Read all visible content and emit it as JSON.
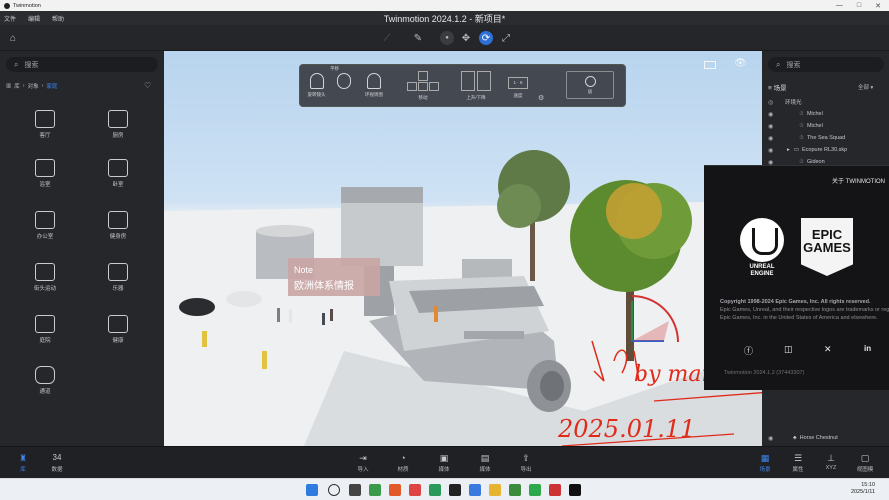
{
  "window": {
    "app_name": "Twinmotion",
    "title": "Twinmotion 2024.1.2 - 新项目*",
    "controls": [
      "—",
      "□",
      "✕"
    ]
  },
  "menu": [
    "文件",
    "编辑",
    "帮助"
  ],
  "left_panel": {
    "search_placeholder": "搜索",
    "breadcrumb": [
      "库",
      "对象",
      "家庭"
    ],
    "categories": [
      {
        "label": "客厅",
        "icon": "sofa-lamp-icon"
      },
      {
        "label": "厨房",
        "icon": "kitchen-icon"
      },
      {
        "label": "浴室",
        "icon": "bath-icon"
      },
      {
        "label": "卧室",
        "icon": "bed-icon"
      },
      {
        "label": "办公室",
        "icon": "desk-icon"
      },
      {
        "label": "健身房",
        "icon": "gym-icon"
      },
      {
        "label": "街头运动",
        "icon": "street-sport-icon"
      },
      {
        "label": "乐器",
        "icon": "guitar-icon"
      },
      {
        "label": "庭院",
        "icon": "garden-fence-icon"
      },
      {
        "label": "健康",
        "icon": "health-icon"
      },
      {
        "label": "通道",
        "icon": "barrel-icon"
      }
    ]
  },
  "viewport_toolbar": {
    "top_label": "平移",
    "items": [
      "旋转镜头",
      "环视周围",
      "移动",
      "上升/下降",
      "速度"
    ],
    "speed_value": "1 · 6",
    "center_button": "居"
  },
  "viewport_overlay_text": {
    "sign_line1": "Note",
    "sign_line2": "欧洲体系情报"
  },
  "handwriting": {
    "line1": "by mango",
    "line2": "2025.01.11"
  },
  "right_panel": {
    "search_placeholder": "搜索",
    "scene_title": "场景",
    "filter": "全部",
    "items": [
      {
        "label": "环境光",
        "icon": "globe-icon",
        "indent": 0
      },
      {
        "label": "Michel",
        "icon": "person-icon",
        "indent": 2
      },
      {
        "label": "Michel",
        "icon": "person-icon",
        "indent": 2
      },
      {
        "label": "The Sea Squad",
        "icon": "person-icon",
        "indent": 2
      },
      {
        "label": "Ecopure RL30.skp",
        "icon": "folder-icon",
        "indent": 1
      },
      {
        "label": "Gideon",
        "icon": "person-icon",
        "indent": 2
      }
    ],
    "bottom_item": "Horse Chestnut"
  },
  "about_dialog": {
    "header": "关于 TWINMOTION",
    "ue_caption": "UNREAL\nENGINE",
    "epic_text": "EPIC\nGAMES",
    "copyright_line1": "Copyright 1998-2024 Epic Games, Inc. All rights reserved.",
    "copyright_line2": "Epic Games, Unreal, and their respective logos are trademarks or registered trademarks of",
    "copyright_line3": "Epic Games, Inc. in the United States of America and elsewhere.",
    "version": "Twinmotion 2024.1.2 (37443307)",
    "social": [
      "facebook-icon",
      "instagram-icon",
      "x-icon",
      "linkedin-icon"
    ]
  },
  "bottom_bar": {
    "left": [
      {
        "label": "库",
        "icon": "library-icon",
        "active": true
      },
      {
        "label": "数据",
        "value": "34",
        "icon": "data-icon",
        "active": false
      }
    ],
    "center": [
      {
        "label": "导入",
        "icon": "import-icon"
      },
      {
        "label": "材质",
        "icon": "material-icon"
      },
      {
        "label": "媒体",
        "icon": "media-icon"
      },
      {
        "label": "媒体",
        "icon": "film-icon"
      },
      {
        "label": "导出",
        "icon": "export-icon"
      }
    ],
    "right": [
      {
        "label": "场景",
        "icon": "scene-icon",
        "active": true
      },
      {
        "label": "属性",
        "icon": "properties-icon",
        "active": false
      },
      {
        "label": "XYZ",
        "icon": "xyz-icon",
        "active": false
      },
      {
        "label": "视图模",
        "icon": "view-mode-icon",
        "active": false
      }
    ]
  },
  "taskbar": {
    "time": "15:10",
    "date": "2025/1/11"
  }
}
